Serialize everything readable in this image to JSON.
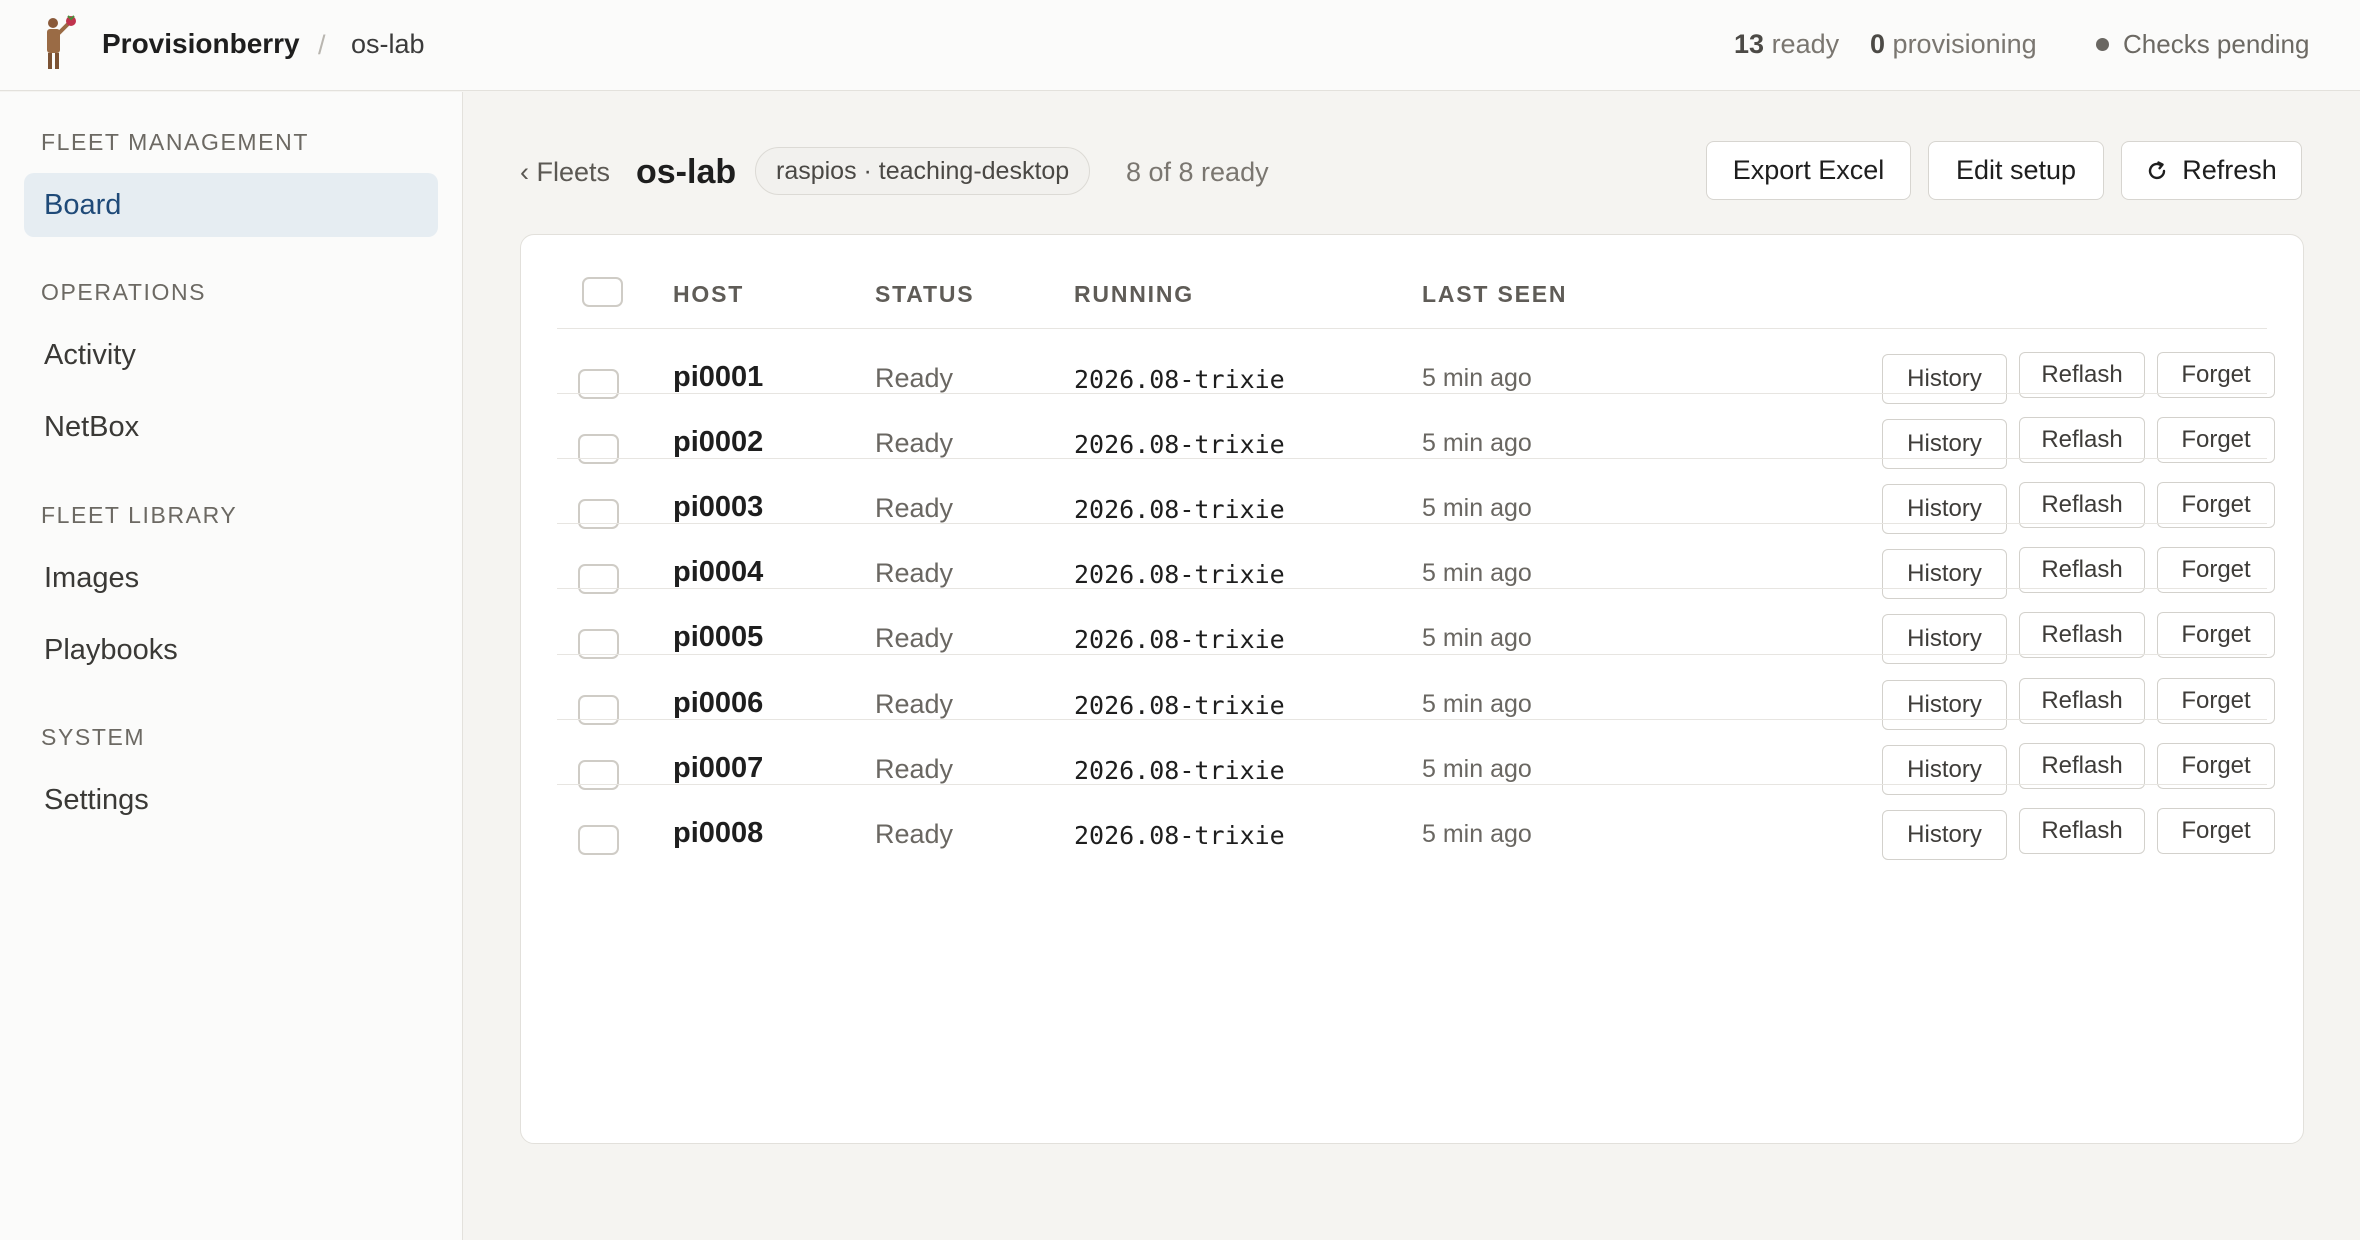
{
  "app": {
    "brand": "Provisionberry",
    "separator": "/",
    "current_fleet": "os-lab"
  },
  "top_stats": {
    "ready_count": "13",
    "ready_label": "ready",
    "provisioning_count": "0",
    "provisioning_label": "provisioning",
    "checks": "Checks pending"
  },
  "sidebar": {
    "sections": [
      {
        "title": "FLEET MANAGEMENT",
        "items": [
          {
            "label": "Board",
            "active": true
          }
        ]
      },
      {
        "title": "OPERATIONS",
        "items": [
          {
            "label": "Activity"
          },
          {
            "label": "NetBox"
          }
        ]
      },
      {
        "title": "FLEET LIBRARY",
        "items": [
          {
            "label": "Images"
          },
          {
            "label": "Playbooks"
          }
        ]
      },
      {
        "title": "SYSTEM",
        "items": [
          {
            "label": "Settings"
          }
        ]
      }
    ]
  },
  "header": {
    "back_label": "‹ Fleets",
    "fleet_name": "os-lab",
    "chip": "raspios · teaching-desktop",
    "ready_summary": "8 of 8 ready",
    "export_label": "Export Excel",
    "edit_label": "Edit setup",
    "refresh_label": "Refresh"
  },
  "table": {
    "columns": [
      "HOST",
      "STATUS",
      "RUNNING",
      "LAST SEEN"
    ],
    "row_actions": [
      "History",
      "Reflash",
      "Forget"
    ],
    "rows": [
      {
        "host": "pi0001",
        "status": "Ready",
        "running": "2026.08-trixie",
        "last_seen": "5 min ago"
      },
      {
        "host": "pi0002",
        "status": "Ready",
        "running": "2026.08-trixie",
        "last_seen": "5 min ago"
      },
      {
        "host": "pi0003",
        "status": "Ready",
        "running": "2026.08-trixie",
        "last_seen": "5 min ago"
      },
      {
        "host": "pi0004",
        "status": "Ready",
        "running": "2026.08-trixie",
        "last_seen": "5 min ago"
      },
      {
        "host": "pi0005",
        "status": "Ready",
        "running": "2026.08-trixie",
        "last_seen": "5 min ago"
      },
      {
        "host": "pi0006",
        "status": "Ready",
        "running": "2026.08-trixie",
        "last_seen": "5 min ago"
      },
      {
        "host": "pi0007",
        "status": "Ready",
        "running": "2026.08-trixie",
        "last_seen": "5 min ago"
      },
      {
        "host": "pi0008",
        "status": "Ready",
        "running": "2026.08-trixie",
        "last_seen": "5 min ago"
      }
    ]
  },
  "icons": {
    "logo": "raspberry-mascot-icon",
    "refresh": "refresh-icon",
    "status_dot": "status-dot-icon"
  },
  "colors": {
    "active_nav_bg": "#e6edf2",
    "active_nav_text": "#1f4a78",
    "page_bg": "#f5f4f1"
  }
}
